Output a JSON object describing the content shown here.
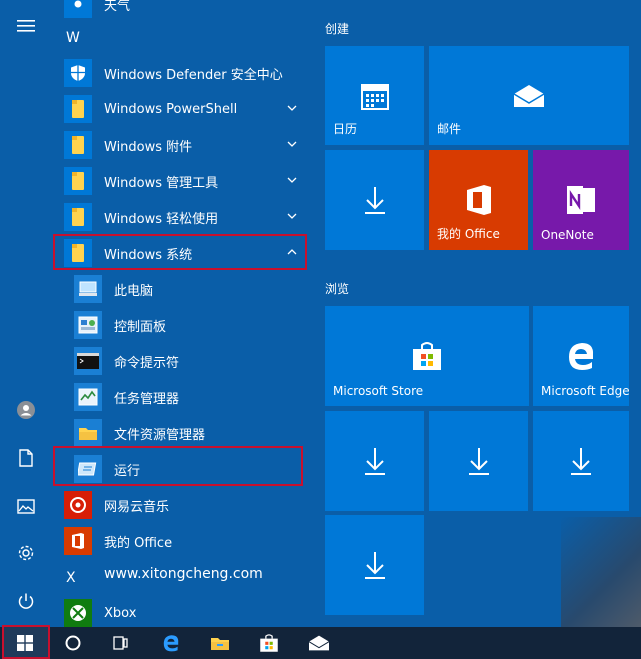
{
  "applist": {
    "top_partial": "天气",
    "letter_w": "W",
    "items": [
      {
        "label": "Windows Defender 安全中心",
        "kind": "app"
      },
      {
        "label": "Windows PowerShell",
        "kind": "folder"
      },
      {
        "label": "Windows 附件",
        "kind": "folder"
      },
      {
        "label": "Windows 管理工具",
        "kind": "folder"
      },
      {
        "label": "Windows 轻松使用",
        "kind": "folder"
      },
      {
        "label": "Windows 系统",
        "kind": "folder-open"
      }
    ],
    "sub_items": [
      {
        "label": "此电脑"
      },
      {
        "label": "控制面板"
      },
      {
        "label": "命令提示符"
      },
      {
        "label": "任务管理器"
      },
      {
        "label": "文件资源管理器"
      },
      {
        "label": "运行"
      }
    ],
    "after": [
      {
        "label": "网易云音乐"
      },
      {
        "label": "我的 Office"
      }
    ],
    "letter_x": "X",
    "xbox": "Xbox",
    "watermark": "www.xitongcheng.com"
  },
  "tiles": {
    "group1": "创建",
    "group2": "浏览",
    "calendar": "日历",
    "mail": "邮件",
    "office": "我的 Office",
    "onenote": "OneNote",
    "store": "Microsoft Store",
    "edge": "Microsoft Edge"
  },
  "colors": {
    "bg": "#0a5ea8",
    "tile": "#0078d7",
    "office": "#d83b01",
    "onenote": "#7719aa",
    "highlight": "#c8102e",
    "taskbar": "#12243a"
  }
}
